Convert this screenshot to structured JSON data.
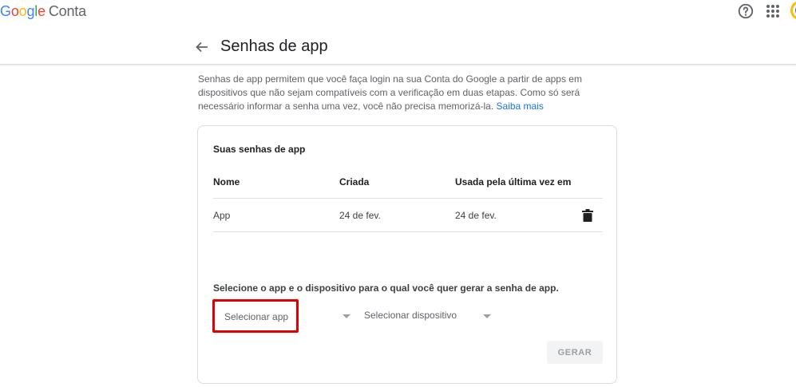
{
  "header": {
    "logo_google": [
      "G",
      "o",
      "o",
      "g",
      "l",
      "e"
    ],
    "logo_product": "Conta"
  },
  "page": {
    "title": "Senhas de app",
    "intro_text": "Senhas de app permitem que você faça login na sua Conta do Google a partir de apps em dispositivos que não sejam compatíveis com a verificação em duas etapas. Como só será necessário informar a senha uma vez, você não precisa memorizá-la.",
    "learn_more": "Saiba mais"
  },
  "passwords": {
    "section_title": "Suas senhas de app",
    "columns": [
      "Nome",
      "Criada",
      "Usada pela última vez em"
    ],
    "rows": [
      {
        "name": "App",
        "created": "24 de fev.",
        "last_used": "24 de fev."
      }
    ]
  },
  "generate": {
    "prompt": "Selecione o app e o dispositivo para o qual você quer gerar a senha de app.",
    "select_app": "Selecionar app",
    "select_device": "Selecionar dispositivo",
    "button": "GERAR"
  },
  "colors": {
    "link": "#1a73e8",
    "highlight": "#e00000",
    "disabled_button_bg": "#f1f3f4"
  }
}
